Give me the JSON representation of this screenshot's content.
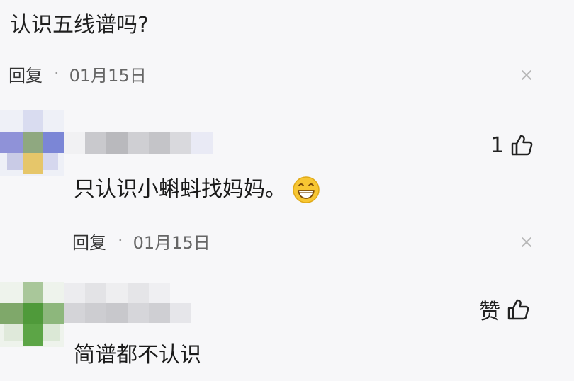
{
  "question": {
    "text": "认识五线谱吗?"
  },
  "top_meta": {
    "reply_label": "回复",
    "separator": "·",
    "date": "01月15日"
  },
  "comments": [
    {
      "text": "只认识小蝌蚪找妈妈。",
      "emoji": "grinning-face-emoji",
      "like_label": "1",
      "reply_label": "回复",
      "separator": "·",
      "date": "01月15日"
    },
    {
      "text": "简谱都不认识",
      "like_label": "赞"
    }
  ],
  "icons": {
    "close": "close-icon",
    "like": "thumbs-up-icon",
    "emoji": "grinning-face-icon"
  },
  "colors": {
    "background": "#f7f7f9",
    "text": "#1f1f1f",
    "muted": "#666666",
    "close": "#b8b8b8",
    "emoji": "#f7c633"
  }
}
